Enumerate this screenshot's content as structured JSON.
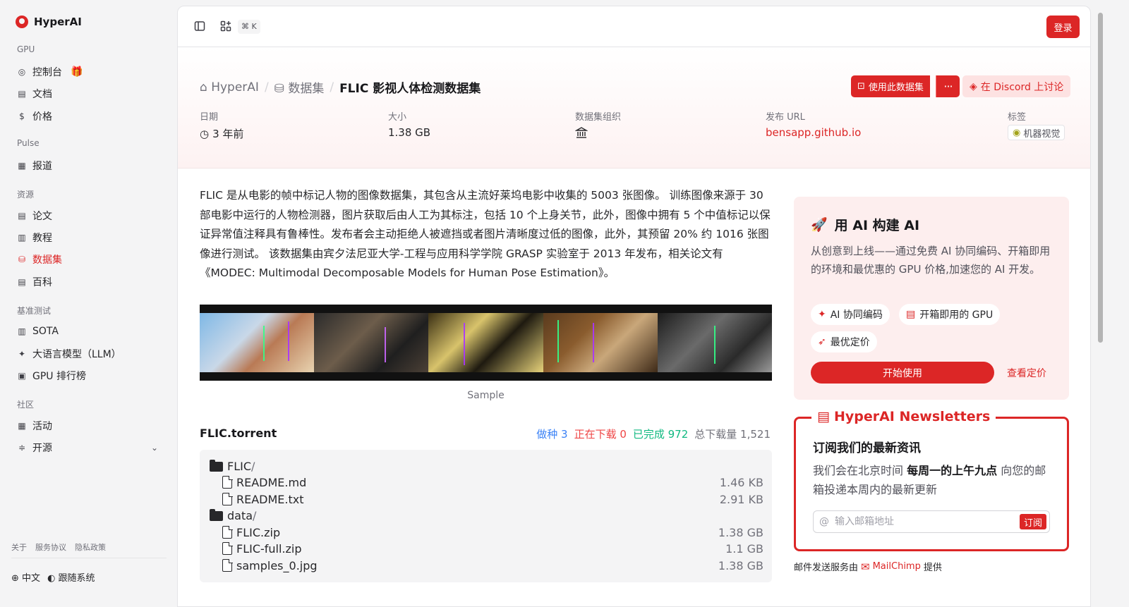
{
  "brand": {
    "name": "HyperAI",
    "accent": "#dc2626"
  },
  "sidebar": {
    "sections": [
      {
        "label": "GPU",
        "items": [
          {
            "label": "控制台",
            "icon": "gauge-icon"
          },
          {
            "label": "文档",
            "icon": "doc-icon"
          },
          {
            "label": "价格",
            "icon": "dollar-icon"
          }
        ]
      },
      {
        "label": "Pulse",
        "items": [
          {
            "label": "报道",
            "icon": "newspaper-icon"
          }
        ]
      },
      {
        "label": "资源",
        "items": [
          {
            "label": "论文",
            "icon": "paper-icon"
          },
          {
            "label": "教程",
            "icon": "book-icon"
          },
          {
            "label": "数据集",
            "icon": "database-icon",
            "active": true
          },
          {
            "label": "百科",
            "icon": "encyclopedia-icon"
          }
        ]
      },
      {
        "label": "基准测试",
        "items": [
          {
            "label": "SOTA",
            "icon": "chart-icon"
          },
          {
            "label": "大语言模型（LLM）",
            "icon": "sparkles-icon"
          },
          {
            "label": "GPU 排行榜",
            "icon": "cpu-icon"
          }
        ]
      },
      {
        "label": "社区",
        "items": [
          {
            "label": "活动",
            "icon": "calendar-icon"
          },
          {
            "label": "开源",
            "icon": "code-icon"
          }
        ]
      }
    ],
    "footer_links": [
      "关于",
      "服务协议",
      "隐私政策"
    ],
    "language": "中文",
    "theme": "跟随系统"
  },
  "topbar": {
    "shortcut": "⌘ K",
    "login": "登录"
  },
  "breadcrumb": {
    "home": "HyperAI",
    "section": "数据集",
    "current": "FLIC 影视人体检测数据集"
  },
  "actions": {
    "use_dataset": "使用此数据集",
    "more": "···",
    "discord": "在 Discord 上讨论"
  },
  "meta": {
    "date_label": "日期",
    "date_value": "3 年前",
    "size_label": "大小",
    "size_value": "1.38 GB",
    "org_label": "数据集组织",
    "url_label": "发布 URL",
    "url_value": "bensapp.github.io",
    "tags_label": "标签",
    "tag": "机器视觉"
  },
  "description": "FLIC 是从电影的帧中标记人物的图像数据集，其包含从主流好莱坞电影中收集的 5003 张图像。 训练图像来源于 30 部电影中运行的人物检测器，图片获取后由人工为其标注，包括 10 个上身关节，此外，图像中拥有 5 个中值标记以保证异常值注释具有鲁棒性。发布者会主动拒绝人被遮挡或者图片清晰度过低的图像，此外，其预留 20% 约 1016 张图像进行测试。 该数据集由宾夕法尼亚大学-工程与应用科学学院 GRASP 实验室于 2013 年发布，相关论文有《MODEC: Multimodal Decomposable Models for Human Pose Estimation》。",
  "sample_caption": "Sample",
  "torrent": {
    "title": "FLIC.torrent",
    "seeding": "做种 3",
    "downloading": "正在下载 0",
    "completed": "已完成 972",
    "total": "总下载量 1,521",
    "files": [
      {
        "name": "FLIC",
        "type": "folder",
        "depth": 0,
        "size": ""
      },
      {
        "name": "README.md",
        "type": "file",
        "depth": 1,
        "size": "1.46 KB"
      },
      {
        "name": "README.txt",
        "type": "file",
        "depth": 1,
        "size": "2.91 KB"
      },
      {
        "name": "data",
        "type": "folder",
        "depth": 0,
        "size": ""
      },
      {
        "name": "FLIC.zip",
        "type": "file",
        "depth": 1,
        "size": "1.38 GB"
      },
      {
        "name": "FLIC-full.zip",
        "type": "file",
        "depth": 1,
        "size": "1.1 GB"
      },
      {
        "name": "samples_0.jpg",
        "type": "file",
        "depth": 1,
        "size": "1.38 GB"
      }
    ]
  },
  "ai_card": {
    "title": "用 AI 构建 AI",
    "desc": "从创意到上线——通过免费 AI 协同编码、开箱即用的环境和最优惠的 GPU 价格,加速您的 AI 开发。",
    "pills": [
      "AI 协同编码",
      "开箱即用的 GPU",
      "最优定价"
    ],
    "start": "开始使用",
    "pricing": "查看定价"
  },
  "newsletter": {
    "title": "HyperAI Newsletters",
    "subtitle": "订阅我们的最新资讯",
    "desc_pre": "我们会在北京时间 ",
    "desc_bold": "每周一的上午九点",
    "desc_post": " 向您的邮箱投递本周内的最新更新",
    "placeholder": "输入邮箱地址",
    "button": "订阅"
  },
  "mailchimp": {
    "pre": "邮件发送服务由",
    "brand": "MailChimp",
    "post": "提供"
  }
}
